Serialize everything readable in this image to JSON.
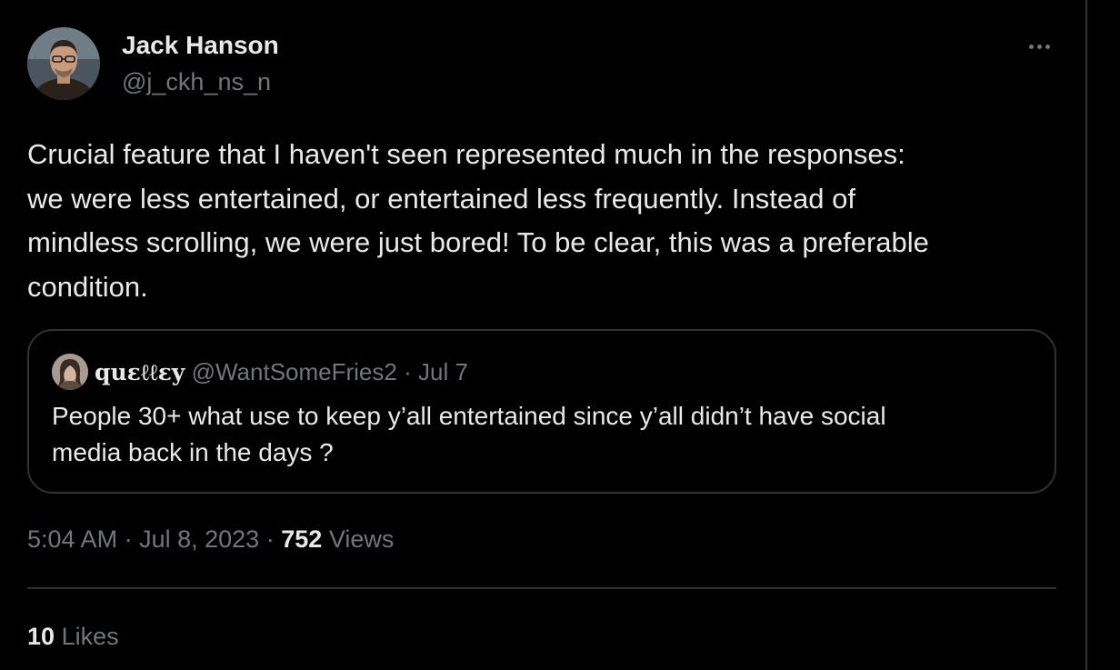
{
  "tweet": {
    "author": {
      "name": "Jack Hanson",
      "handle": "@j_ckh_ns_n"
    },
    "text": "Crucial feature that I haven't seen represented much in the responses:\nwe were less entertained, or entertained less frequently. Instead of\nmindless scrolling, we were just bored! To be clear, this was a preferable\ncondition.",
    "quote": {
      "name": "quεℓℓεy",
      "handle": "@WantSomeFries2",
      "separator": "·",
      "date": "Jul 7",
      "text": "People 30+ what use to keep y’all entertained since y’all didn’t have social\nmedia back in the days ?"
    },
    "meta": {
      "time": "5:04 AM",
      "separator": "·",
      "date": "Jul 8, 2023",
      "views_count": "752",
      "views_label": "Views"
    },
    "stats": {
      "likes_count": "10",
      "likes_label": "Likes"
    }
  },
  "icons": {
    "more": "more-horizontal-icon"
  },
  "colors": {
    "background": "#000000",
    "text_primary": "#e7e9ea",
    "text_secondary": "#71767b",
    "border": "#2f3336"
  }
}
